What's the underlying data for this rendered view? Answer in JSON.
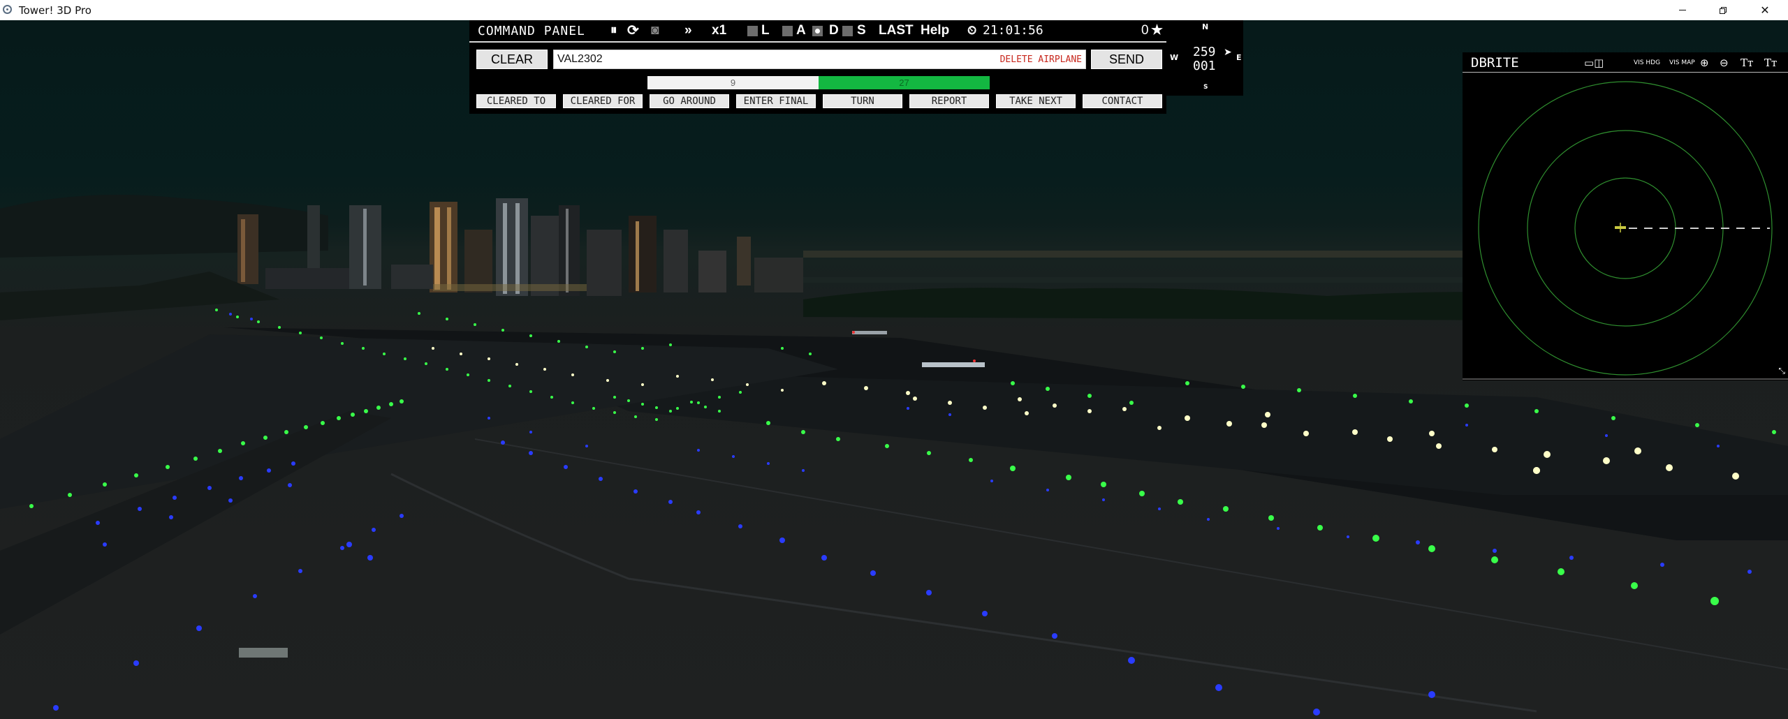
{
  "window": {
    "title": "Tower! 3D Pro"
  },
  "command_panel": {
    "title": "COMMAND PANEL",
    "toolbar": {
      "pause_icon": "pause-icon",
      "reload_icon": "reload-icon",
      "camera_icon": "camera-icon",
      "fast_forward": "»",
      "speed": "x1",
      "l_label": "L",
      "a_label": "A",
      "d_label": "D",
      "s_label": "S",
      "last": "LAST",
      "help": "Help",
      "clock_icon": "clock-icon",
      "time": "21:01:56",
      "score": "0",
      "star_icon": "star-icon"
    },
    "clear_label": "CLEAR",
    "callsign_value": "VAL2302",
    "delete_label": "DELETE AIRPLANE",
    "send_label": "SEND",
    "runway": {
      "left": "9",
      "right": "27",
      "active_color": "#13b741"
    },
    "commands": [
      "CLEARED TO",
      "CLEARED FOR",
      "GO AROUND",
      "ENTER FINAL",
      "TURN",
      "REPORT",
      "TAKE NEXT",
      "CONTACT"
    ]
  },
  "compass": {
    "n": "N",
    "s": "S",
    "w": "W",
    "e": "E",
    "heading": "259",
    "altitude": "001"
  },
  "dbrite": {
    "title": "DBRITE",
    "vis_hdg": "VIS HDG",
    "vis_map": "VIS MAP",
    "zoom_in_icon": "zoom-in-icon",
    "zoom_out_icon": "zoom-out-icon",
    "text_size_up_icon": "text-size-up-icon",
    "text_size_down_icon": "text-size-down-icon",
    "window_toggle_icon": "window-toggle-icon",
    "ring_color": "#2f8f2f"
  }
}
